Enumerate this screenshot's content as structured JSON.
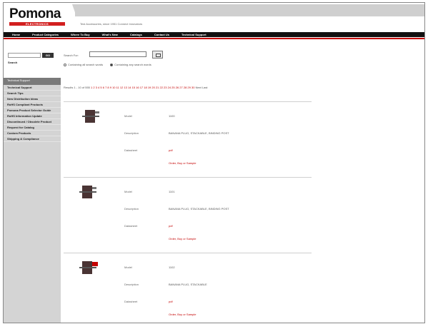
{
  "header": {
    "logo_word": "Pomona",
    "logo_sub": "ELECTRONICS",
    "tagline": "Test Accessories, since 1951 Connect Innovators"
  },
  "nav": {
    "items": [
      "Home",
      "Product Categories",
      "Where To Buy",
      "What's New",
      "Catalogs",
      "Contact Us",
      "Technical Support"
    ]
  },
  "sidebar": {
    "search_placeholder": "",
    "go_label": "GO",
    "search_label": "Search",
    "section_title": "Technical Support",
    "items": [
      "Technical Support",
      "Search Tips",
      "New Distribution Ideas",
      "RoHS Compliant Products",
      "Pomona Product Selector Guide",
      "RoHS Information Update",
      "Discontinued / Obsolete Product",
      "Request for Catalog",
      "Custom Products",
      "Shipping & Compliance"
    ]
  },
  "search": {
    "label": "Search For:",
    "value": "",
    "radios": [
      {
        "label": "Containing all search words",
        "checked": false
      },
      {
        "label": "Containing any search words",
        "checked": true
      }
    ]
  },
  "results": {
    "prefix": "Results 1 - 10 of 555",
    "pages": "1 2 3 4 5 6 7 8 9 10 11 12 13 14 15 16 17 18 19 20 21 22 23 24 25 26 27 28 29 30",
    "next": "Next",
    "last": "Last"
  },
  "products": [
    {
      "model_label": "Model",
      "model": "1100",
      "description_label": "Description",
      "description": "BANANA PLUG, STACKABLE, BINDING POST",
      "datasheet_label": "Datasheet",
      "datasheet": "pdf",
      "link": "Order, Buy or Sample"
    },
    {
      "model_label": "Model",
      "model": "1101",
      "description_label": "Description",
      "description": "BANANA PLUG, STACKABLE, BINDING POST",
      "datasheet_label": "Datasheet",
      "datasheet": "pdf",
      "link": "Order, Buy or Sample"
    },
    {
      "model_label": "Model",
      "model": "1102",
      "description_label": "Description",
      "description": "BANANA PLUG, STACKABLE",
      "datasheet_label": "Datasheet",
      "datasheet": "pdf",
      "link": "Order, Buy or Sample"
    }
  ]
}
